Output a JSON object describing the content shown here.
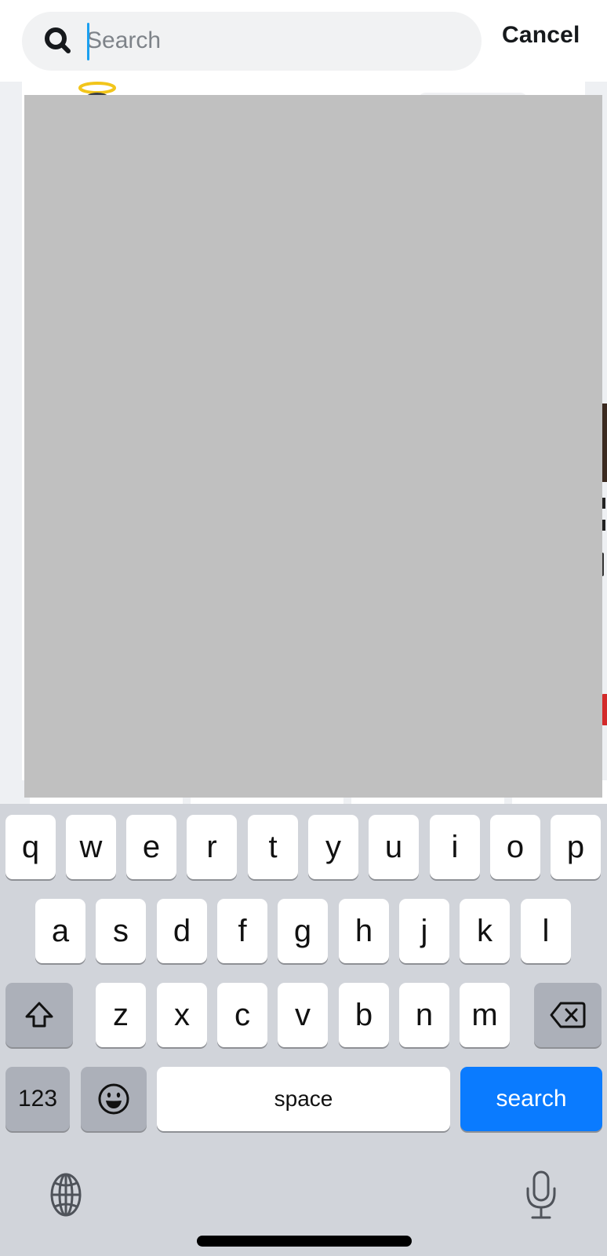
{
  "header": {
    "search_placeholder": "Search",
    "search_value": "",
    "cancel_label": "Cancel"
  },
  "keyboard": {
    "row1": [
      "q",
      "w",
      "e",
      "r",
      "t",
      "y",
      "u",
      "i",
      "o",
      "p"
    ],
    "row2": [
      "a",
      "s",
      "d",
      "f",
      "g",
      "h",
      "j",
      "k",
      "l"
    ],
    "row3": [
      "z",
      "x",
      "c",
      "v",
      "b",
      "n",
      "m"
    ],
    "numbers_label": "123",
    "space_label": "space",
    "search_label": "search",
    "icons": {
      "shift": "shift-icon",
      "delete": "delete-backspace-icon",
      "emoji": "emoji-icon",
      "globe": "globe-icon",
      "mic": "microphone-icon"
    }
  },
  "colors": {
    "accent": "#0a7bff",
    "caret": "#1aa0f0",
    "keyboard_bg": "#d1d4da",
    "redaction": "#c0c0c0"
  }
}
